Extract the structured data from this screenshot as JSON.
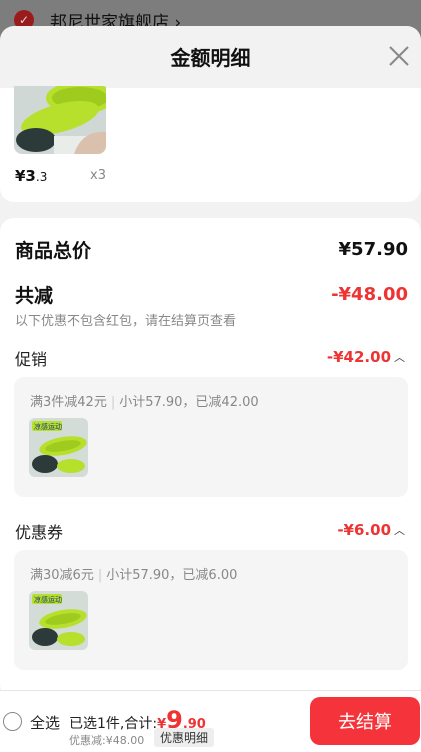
{
  "background": {
    "shop_name": "邦尼世家旗舰店 ›"
  },
  "sheet": {
    "title": "金额明细"
  },
  "item": {
    "price_main": "¥3",
    "price_dec": ".3",
    "quantity": "x3"
  },
  "summary": {
    "total_label": "商品总价",
    "total_value": "¥57.90",
    "discount_label": "共减",
    "discount_value": "-¥48.00",
    "note": "以下优惠不包含红包，请在结算页查看"
  },
  "promotion": {
    "label": "促销",
    "value": "-¥42.00",
    "rule": "满3件减42元",
    "subtotal": "小计57.90，已减42.00"
  },
  "coupon": {
    "label": "优惠券",
    "value": "-¥6.00",
    "rule": "满30减6元",
    "subtotal": "小计57.90，已减6.00"
  },
  "product_image": {
    "badge_text": "凉感运动"
  },
  "bottom_bar": {
    "select_all": "全选",
    "selected_text": "已选1件,合计:",
    "price_currency": "¥",
    "price_int": "9",
    "price_dec": ".90",
    "discount_text": "优惠减:¥48.00",
    "detail_chip": "优惠明细",
    "checkout_label": "去结算"
  },
  "colors": {
    "accent_red": "#f4343a",
    "discount_red": "#e33333",
    "insole_green": "#b6e02c"
  }
}
